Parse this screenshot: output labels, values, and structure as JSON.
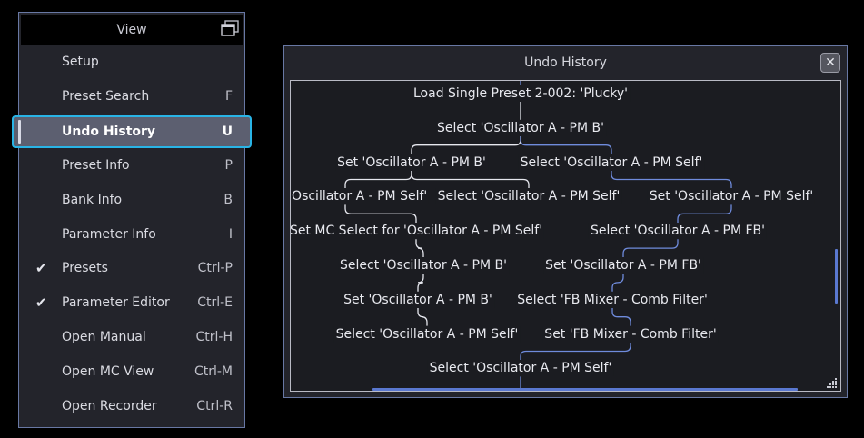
{
  "menu": {
    "title": "View",
    "items": [
      {
        "label": "Setup",
        "shortcut": "",
        "checked": false
      },
      {
        "label": "Preset Search",
        "shortcut": "F",
        "checked": false
      },
      {
        "label": "Undo History",
        "shortcut": "U",
        "checked": false,
        "selected": true
      },
      {
        "label": "Preset Info",
        "shortcut": "P",
        "checked": false
      },
      {
        "label": "Bank Info",
        "shortcut": "B",
        "checked": false
      },
      {
        "label": "Parameter Info",
        "shortcut": "I",
        "checked": false
      },
      {
        "label": "Presets",
        "shortcut": "Ctrl-P",
        "checked": true
      },
      {
        "label": "Parameter Editor",
        "shortcut": "Ctrl-E",
        "checked": true
      },
      {
        "label": "Open Manual",
        "shortcut": "Ctrl-H",
        "checked": false
      },
      {
        "label": "Open MC View",
        "shortcut": "Ctrl-M",
        "checked": false
      },
      {
        "label": "Open Recorder",
        "shortcut": "Ctrl-R",
        "checked": false
      }
    ],
    "check_glyph": "✔"
  },
  "undo_window": {
    "title": "Undo History",
    "close_glyph": "✕",
    "nodes": [
      "Load Single Preset 2-002: 'Plucky'",
      "Select 'Oscillator A - PM B'",
      "Set 'Oscillator A - PM B'",
      "Select 'Oscillator A - PM Self'",
      "Set 'Oscillator A - PM Self'",
      "Select 'Oscillator A - PM Self'",
      "Set 'Oscillator A - PM Self'",
      "Set MC Select for 'Oscillator A - PM Self'",
      "Select 'Oscillator A - PM FB'",
      "Select 'Oscillator A - PM B'",
      "Set 'Oscillator A - PM FB'",
      "Set 'Oscillator A - PM B'",
      "Select 'FB Mixer - Comb Filter'",
      "Select 'Oscillator A - PM Self'",
      "Set 'FB Mixer - Comb Filter'",
      "Select 'Oscillator A - PM Self'"
    ]
  },
  "colors": {
    "accent": "#29b4e6",
    "line_white": "#e6e7ee",
    "line_blue": "#6f8bdc",
    "panel": "#23242b"
  }
}
